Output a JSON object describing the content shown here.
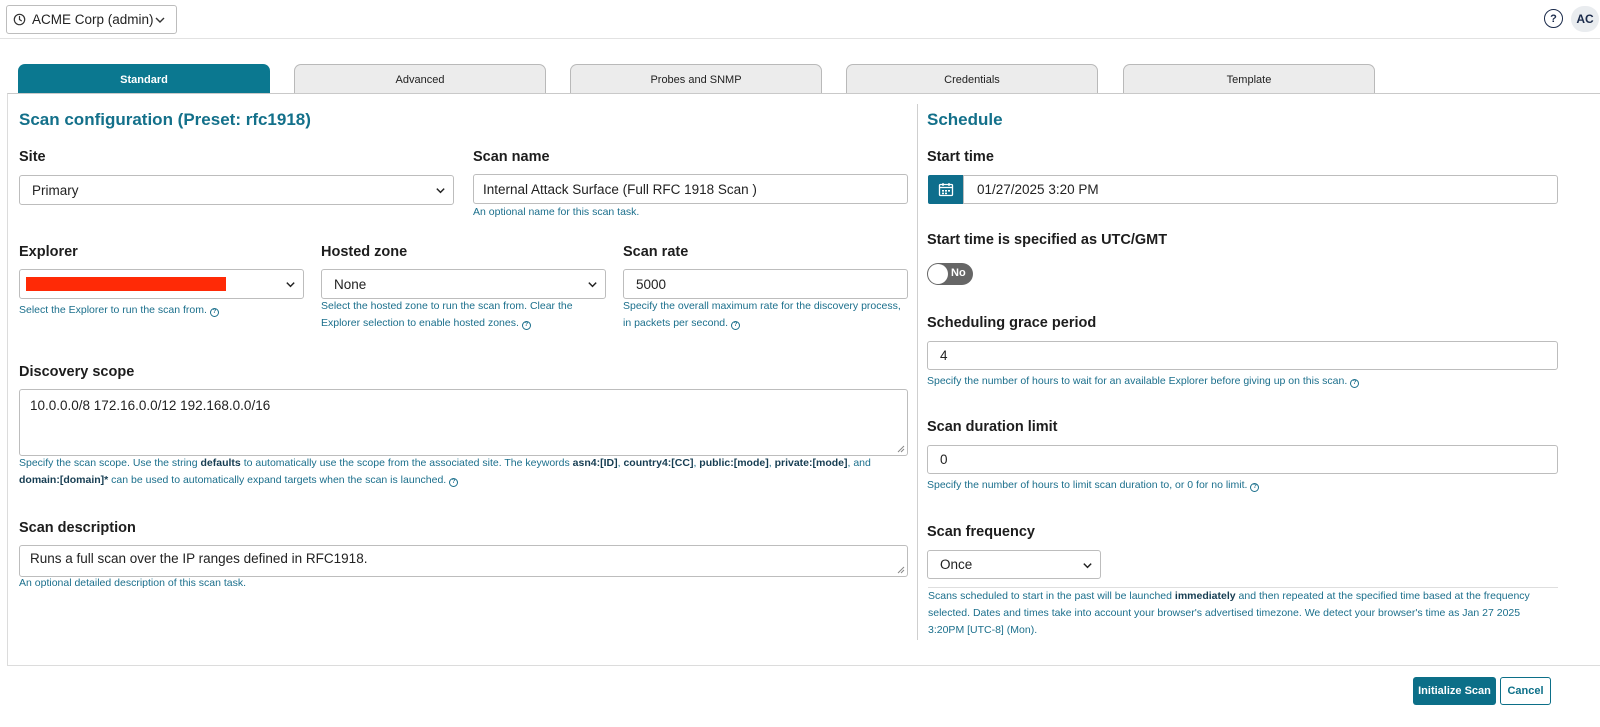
{
  "header": {
    "org_selector": "ACME Corp (admin)",
    "help": "?",
    "avatar": "AC"
  },
  "tabs": [
    {
      "label": "Standard",
      "active": true
    },
    {
      "label": "Advanced",
      "active": false
    },
    {
      "label": "Probes and SNMP",
      "active": false
    },
    {
      "label": "Credentials",
      "active": false
    },
    {
      "label": "Template",
      "active": false
    }
  ],
  "scan_config": {
    "title": "Scan configuration (Preset: rfc1918)",
    "site": {
      "label": "Site",
      "value": "Primary"
    },
    "scan_name": {
      "label": "Scan name",
      "value": "Internal Attack Surface (Full RFC 1918 Scan )",
      "help": "An optional name for this scan task."
    },
    "explorer": {
      "label": "Explorer",
      "help": "Select the Explorer to run the scan from."
    },
    "hosted_zone": {
      "label": "Hosted zone",
      "value": "None",
      "help_line1": "Select the hosted zone to run the scan from. Clear the",
      "help_line2": "Explorer selection to enable hosted zones."
    },
    "scan_rate": {
      "label": "Scan rate",
      "value": "5000",
      "help_line1": "Specify the overall maximum rate for the discovery process,",
      "help_line2": "in packets per second."
    },
    "discovery_scope": {
      "label": "Discovery scope",
      "value": "10.0.0.0/8 172.16.0.0/12 192.168.0.0/16",
      "help_1": "Specify the scan scope. Use the string ",
      "kw_defaults": "defaults",
      "help_2": " to automatically use the scope from the associated site. The keywords ",
      "kw_asn4": "asn4:[ID]",
      "sep_1": ", ",
      "kw_country4": "country4:[CC]",
      "sep_2": ", ",
      "kw_public": "public:[mode]",
      "sep_3": ", ",
      "kw_private": "private:[mode]",
      "sep_4": ", and",
      "kw_domain": "domain:[domain]*",
      "help_3": " can be used to automatically expand targets when the scan is launched."
    },
    "scan_description": {
      "label": "Scan description",
      "value": "Runs a full scan over the IP ranges defined in RFC1918.",
      "help": "An optional detailed description of this scan task."
    }
  },
  "schedule": {
    "title": "Schedule",
    "start_time": {
      "label": "Start time",
      "value": "01/27/2025 3:20 PM"
    },
    "utc": {
      "label": "Start time is specified as UTC/GMT",
      "toggle_text": "No",
      "enabled": false
    },
    "grace": {
      "label": "Scheduling grace period",
      "value": "4",
      "help": "Specify the number of hours to wait for an available Explorer before giving up on this scan."
    },
    "duration": {
      "label": "Scan duration limit",
      "value": "0",
      "help": "Specify the number of hours to limit scan duration to, or 0 for no limit."
    },
    "frequency": {
      "label": "Scan frequency",
      "value": "Once"
    },
    "note": {
      "part1": "Scans scheduled to start in the past will be launched ",
      "bold": "immediately",
      "part2": " and then repeated at the specified time based at the frequency",
      "line2": "selected. Dates and times take into account your browser's advertised timezone. We detect your browser's time as Jan 27 2025",
      "line3": "3:20PM [UTC-8] (Mon)."
    }
  },
  "actions": {
    "initialize": "Initialize Scan",
    "cancel": "Cancel"
  },
  "colors": {
    "accent": "#0b7890",
    "redaction": "#ff2a06",
    "toggle_off": "#666666"
  }
}
